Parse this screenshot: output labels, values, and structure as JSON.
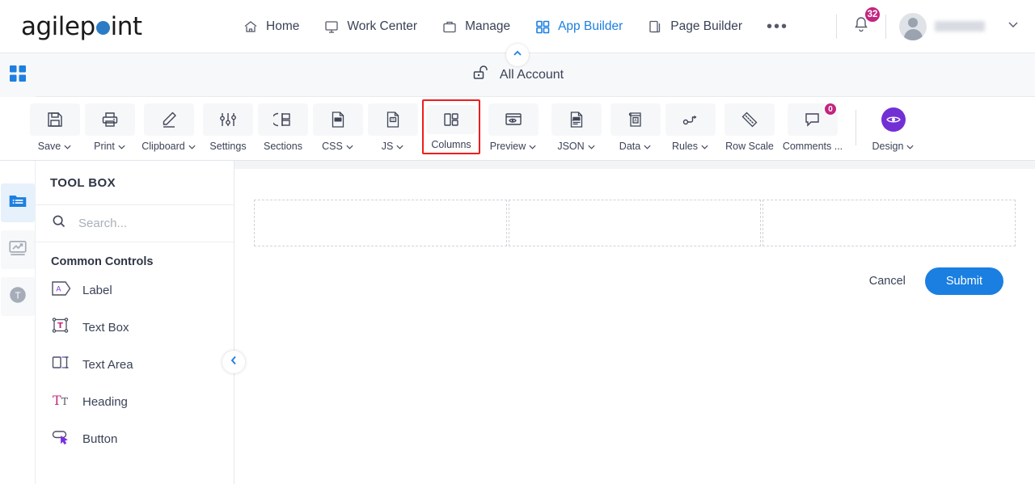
{
  "header": {
    "logo_text_before": "agilep",
    "logo_dot": "o",
    "logo_text_after": "int",
    "nav": [
      {
        "label": "Home",
        "icon": "home-icon",
        "active": false
      },
      {
        "label": "Work Center",
        "icon": "monitor-icon",
        "active": false
      },
      {
        "label": "Manage",
        "icon": "briefcase-icon",
        "active": false
      },
      {
        "label": "App Builder",
        "icon": "grid-icon",
        "active": true
      },
      {
        "label": "Page Builder",
        "icon": "pages-icon",
        "active": false
      }
    ],
    "more_label": "•••",
    "notification_count": "32",
    "notification_color": "#c2257f",
    "username": "",
    "accent_color": "#1d7fe0"
  },
  "account_bar": {
    "title": "All Account",
    "icon": "unlock-icon",
    "grid_icon": "app-grid-icon",
    "collapse_icon": "chevron-up-icon"
  },
  "toolbar": {
    "items": [
      {
        "label": "Save",
        "icon": "save-floppy-icon",
        "caret": true,
        "highlight": false
      },
      {
        "label": "Print",
        "icon": "printer-icon",
        "caret": true,
        "highlight": false
      },
      {
        "label": "Clipboard",
        "icon": "pencil-icon",
        "caret": true,
        "highlight": false
      },
      {
        "label": "Settings",
        "icon": "sliders-icon",
        "caret": false,
        "highlight": false
      },
      {
        "label": "Sections",
        "icon": "sections-icon",
        "caret": false,
        "highlight": false
      },
      {
        "label": "CSS",
        "icon": "css-file-icon",
        "caret": true,
        "highlight": false
      },
      {
        "label": "JS",
        "icon": "js-file-icon",
        "caret": true,
        "highlight": false
      },
      {
        "label": "Columns",
        "icon": "columns-icon",
        "caret": false,
        "highlight": true
      },
      {
        "label": "Preview",
        "icon": "eye-window-icon",
        "caret": true,
        "highlight": false
      },
      {
        "label": "JSON",
        "icon": "json-file-icon",
        "caret": true,
        "highlight": false
      },
      {
        "label": "Data",
        "icon": "data-book-icon",
        "caret": true,
        "highlight": false
      },
      {
        "label": "Rules",
        "icon": "rules-flow-icon",
        "caret": true,
        "highlight": false
      },
      {
        "label": "Row Scale",
        "icon": "ruler-icon",
        "caret": false,
        "highlight": false
      },
      {
        "label": "Comments ...",
        "icon": "comment-icon",
        "caret": false,
        "highlight": false,
        "badge": "0"
      }
    ],
    "design": {
      "label": "Design",
      "icon": "design-eye-icon",
      "caret": true,
      "color": "#7230d4"
    },
    "highlight_color": "#ee1d1d"
  },
  "rail": {
    "items": [
      {
        "name": "toolbox-panel",
        "icon": "folder-list-icon",
        "active": true
      },
      {
        "name": "analytics-panel",
        "icon": "chart-monitor-icon",
        "active": false
      },
      {
        "name": "theme-panel",
        "icon": "letter-t-icon",
        "active": false
      }
    ]
  },
  "toolbox": {
    "title": "TOOL BOX",
    "search_placeholder": "Search...",
    "search_value": "",
    "group_title": "Common Controls",
    "controls": [
      {
        "label": "Label",
        "icon": "label-tag-icon"
      },
      {
        "label": "Text Box",
        "icon": "textbox-icon"
      },
      {
        "label": "Text Area",
        "icon": "textarea-icon"
      },
      {
        "label": "Heading",
        "icon": "heading-icon"
      },
      {
        "label": "Button",
        "icon": "button-icon"
      }
    ],
    "collapse_icon": "chevron-left-icon"
  },
  "canvas": {
    "columns": [
      {
        "name": "column-dropzone-1"
      },
      {
        "name": "column-dropzone-2"
      },
      {
        "name": "column-dropzone-3"
      }
    ],
    "cancel_label": "Cancel",
    "submit_label": "Submit",
    "submit_color": "#1a7fe0"
  }
}
